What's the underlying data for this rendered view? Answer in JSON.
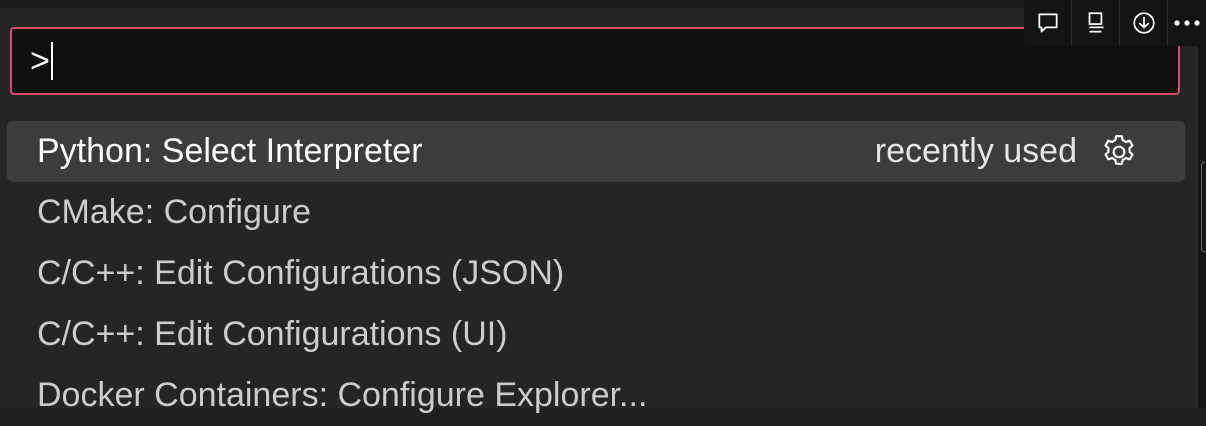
{
  "toolbar": {
    "buttons": [
      {
        "icon": "comment-icon"
      },
      {
        "icon": "layout-panel-icon"
      },
      {
        "icon": "download-circle-icon"
      },
      {
        "icon": "more-icon"
      }
    ]
  },
  "command_palette": {
    "input_value": ">",
    "items": [
      {
        "label": "Python: Select Interpreter",
        "detail": "recently used",
        "icon": "gear-icon",
        "selected": true
      },
      {
        "label": "CMake: Configure"
      },
      {
        "label": "C/C++: Edit Configurations (JSON)"
      },
      {
        "label": "C/C++: Edit Configurations (UI)"
      },
      {
        "label": "Docker Containers: Configure Explorer..."
      }
    ]
  },
  "colors": {
    "focus_border": "#d9496a",
    "selected_row": "#3c3c3c",
    "background": "#252526"
  }
}
